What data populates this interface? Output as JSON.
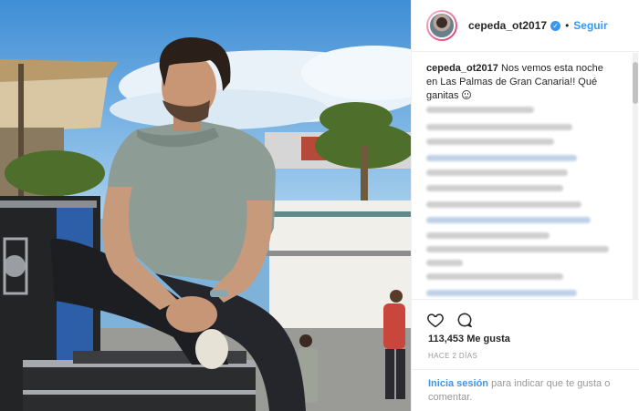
{
  "post": {
    "username": "cepeda_ot2017",
    "verified_icon": "verified-badge-icon",
    "separator": "•",
    "follow_label": "Seguir",
    "caption_user": "cepeda_ot2017",
    "caption_text": "Nos vemos esta noche en Las Palmas de Gran Canaria!! Qué ganitas",
    "likes": "113,453 Me gusta",
    "time_ago": "HACE 2 DÍAS",
    "login_link": "Inicia sesión",
    "login_text": "para indicar que te gusta o comentar."
  },
  "icons": {
    "like": "heart-icon",
    "comment": "comment-icon",
    "emoji": "smile-emoji-icon"
  },
  "colors": {
    "accent": "#3897f0",
    "text": "#262626",
    "muted": "#999999",
    "border": "#efefef"
  }
}
